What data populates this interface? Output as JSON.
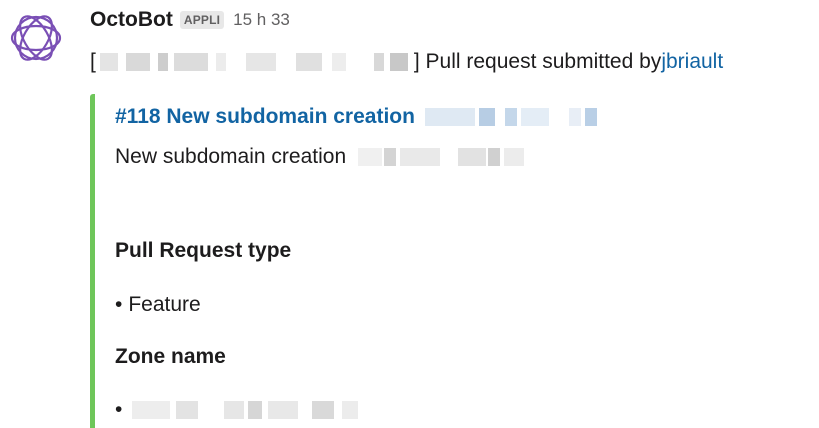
{
  "message": {
    "sender": "OctoBot",
    "badge": "APPLI",
    "timestamp": "15 h 33",
    "text_open_bracket": "[",
    "text_close": "] Pull request submitted by ",
    "user_link": "jbriault",
    "avatar_icon": "octobot-logo-icon"
  },
  "attachment": {
    "color": "#6ec65a",
    "title": "#118 New subdomain creation",
    "subtitle": "New subdomain creation",
    "sections": [
      {
        "heading": "Pull Request type",
        "bullet": "•",
        "item": "Feature"
      },
      {
        "heading": "Zone name",
        "bullet": "•",
        "item": ""
      }
    ]
  },
  "colors": {
    "link": "#1264a3",
    "text": "#1d1c1d",
    "muted": "#616061",
    "avatar": "#7a4fb5"
  }
}
